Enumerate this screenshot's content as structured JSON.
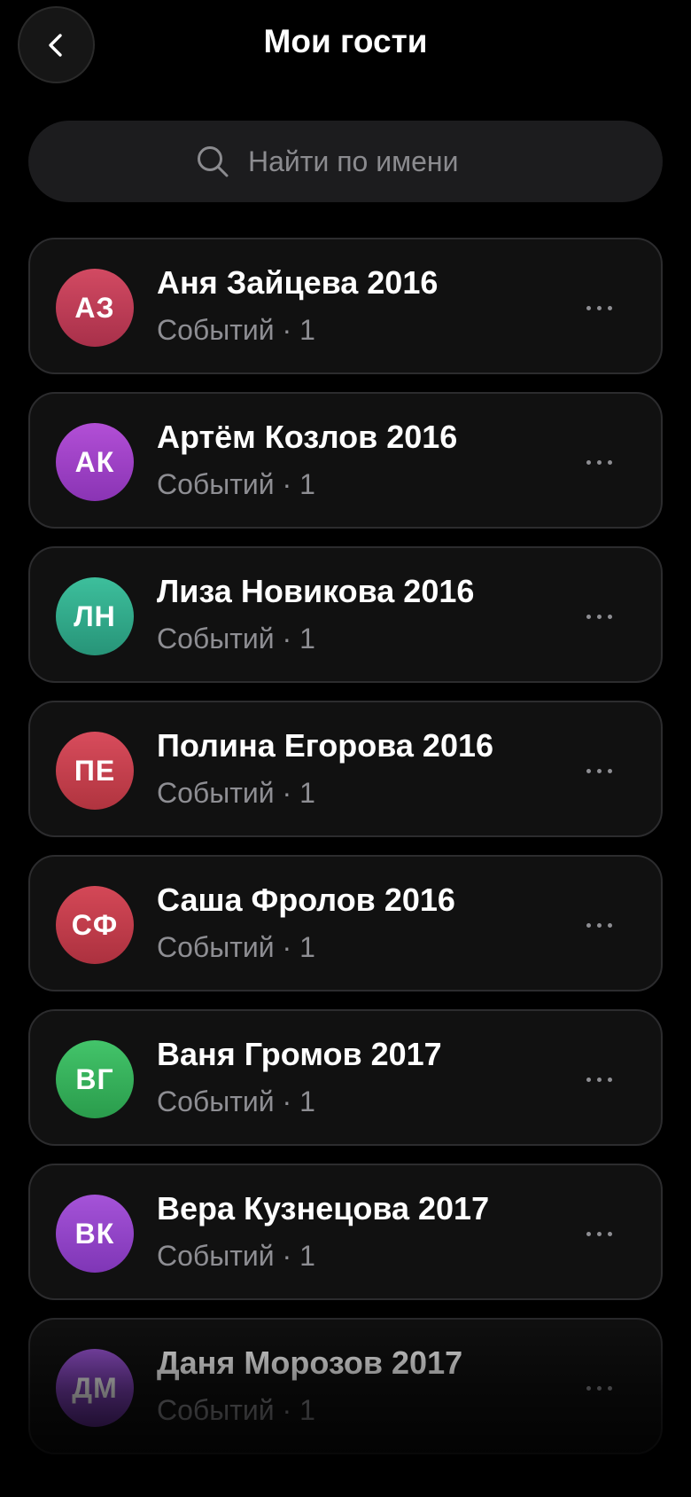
{
  "header": {
    "title": "Мои гости",
    "back_icon": "chevron-left-icon"
  },
  "search": {
    "placeholder": "Найти по имени",
    "value": "",
    "icon": "search-icon"
  },
  "colors": {
    "background": "#000000",
    "card": "#111111",
    "card_border": "#2c2c2e",
    "secondary_text": "#8e8e93"
  },
  "guests": [
    {
      "initials": "АЗ",
      "name": "Аня Зайцева 2016",
      "meta": "Событий · 1",
      "color_top": "#d24a62",
      "color_bottom": "#a8304a"
    },
    {
      "initials": "АК",
      "name": "Артём Козлов 2016",
      "meta": "Событий · 1",
      "color_top": "#b24fd6",
      "color_bottom": "#8a34b4"
    },
    {
      "initials": "ЛН",
      "name": "Лиза Новикова 2016",
      "meta": "Событий · 1",
      "color_top": "#3dbf9c",
      "color_bottom": "#279478"
    },
    {
      "initials": "ПЕ",
      "name": "Полина Егорова 2016",
      "meta": "Событий · 1",
      "color_top": "#d84c5c",
      "color_bottom": "#b0343f"
    },
    {
      "initials": "СФ",
      "name": "Саша Фролов 2016",
      "meta": "Событий · 1",
      "color_top": "#d44857",
      "color_bottom": "#ac313f"
    },
    {
      "initials": "ВГ",
      "name": "Ваня Громов 2017",
      "meta": "Событий · 1",
      "color_top": "#43c46a",
      "color_bottom": "#2a9c4c"
    },
    {
      "initials": "ВК",
      "name": "Вера Кузнецова 2017",
      "meta": "Событий · 1",
      "color_top": "#a553d8",
      "color_bottom": "#7f36b6"
    },
    {
      "initials": "ДМ",
      "name": "Даня Морозов 2017",
      "meta": "Событий · 1",
      "color_top": "#9a55d4",
      "color_bottom": "#6e34a8"
    }
  ]
}
